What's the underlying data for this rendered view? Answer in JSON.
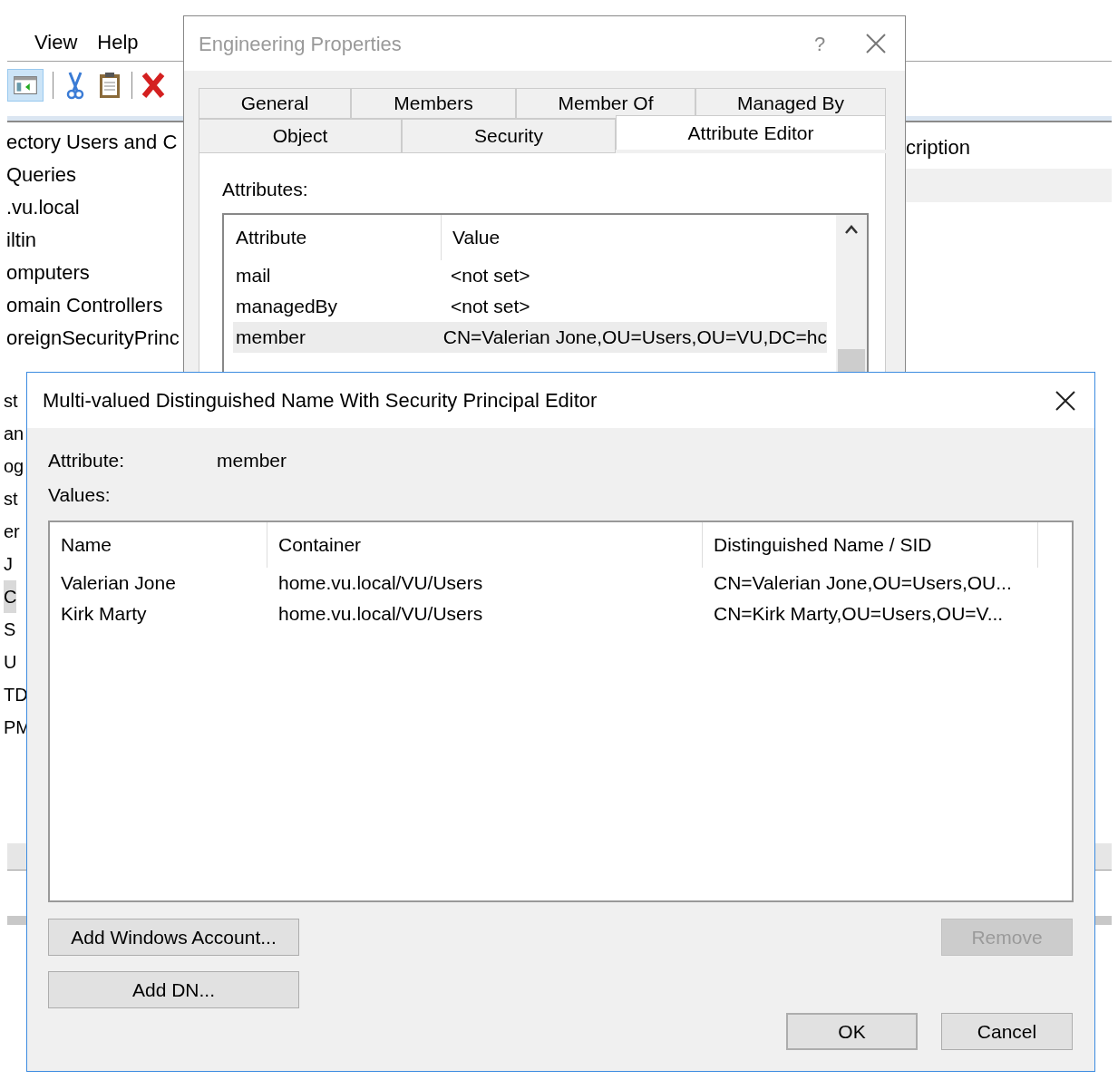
{
  "background_window": {
    "menu": [
      "View",
      "Help"
    ],
    "tree_items": [
      {
        "label": "ectory Users and C",
        "selected": false
      },
      {
        "label": "Queries",
        "selected": false
      },
      {
        "label": ".vu.local",
        "selected": false
      },
      {
        "label": "iltin",
        "selected": false
      },
      {
        "label": "omputers",
        "selected": false
      },
      {
        "label": "omain Controllers",
        "selected": false
      },
      {
        "label": "oreignSecurityPrinc",
        "selected": false
      }
    ],
    "clipped_items": [
      {
        "label": "st",
        "selected": false
      },
      {
        "label": "an",
        "selected": false
      },
      {
        "label": "og",
        "selected": false
      },
      {
        "label": "st",
        "selected": false
      },
      {
        "label": "er",
        "selected": false
      },
      {
        "label": "J",
        "selected": false
      },
      {
        "label": "C",
        "selected": true
      },
      {
        "label": "S",
        "selected": false
      },
      {
        "label": "U",
        "selected": false
      },
      {
        "label": "TD",
        "selected": false
      },
      {
        "label": "PM",
        "selected": false
      }
    ],
    "list_column": "cription"
  },
  "properties_dialog": {
    "title": "Engineering Properties",
    "help": "?",
    "tab_rows": [
      [
        {
          "label": "General",
          "selected": false
        },
        {
          "label": "Members",
          "selected": false
        },
        {
          "label": "Member Of",
          "selected": false
        },
        {
          "label": "Managed By",
          "selected": false
        }
      ],
      [
        {
          "label": "Object",
          "selected": false
        },
        {
          "label": "Security",
          "selected": false
        },
        {
          "label": "Attribute Editor",
          "selected": true
        }
      ]
    ],
    "section_label": "Attributes:",
    "columns": [
      "Attribute",
      "Value"
    ],
    "rows": [
      {
        "attribute": "mail",
        "value": "<not set>",
        "selected": false
      },
      {
        "attribute": "managedBy",
        "value": "<not set>",
        "selected": false
      },
      {
        "attribute": "member",
        "value": "CN=Valerian Jone,OU=Users,OU=VU,DC=hc",
        "selected": true
      }
    ]
  },
  "editor_dialog": {
    "title": "Multi-valued Distinguished Name With Security Principal Editor",
    "attribute_label": "Attribute:",
    "attribute_value": "member",
    "values_label": "Values:",
    "columns": [
      "Name",
      "Container",
      "Distinguished Name / SID"
    ],
    "rows": [
      {
        "name": "Valerian Jone",
        "container": "home.vu.local/VU/Users",
        "dn": "CN=Valerian Jone,OU=Users,OU..."
      },
      {
        "name": "Kirk Marty",
        "container": "home.vu.local/VU/Users",
        "dn": "CN=Kirk Marty,OU=Users,OU=V..."
      }
    ],
    "buttons": [
      {
        "label": "Add Windows Account...",
        "disabled": false,
        "default": false
      },
      {
        "label": "Add DN...",
        "disabled": false,
        "default": false
      },
      {
        "label": "Remove",
        "disabled": true,
        "default": false
      },
      {
        "label": "OK",
        "disabled": false,
        "default": true
      },
      {
        "label": "Cancel",
        "disabled": false,
        "default": false
      }
    ]
  }
}
